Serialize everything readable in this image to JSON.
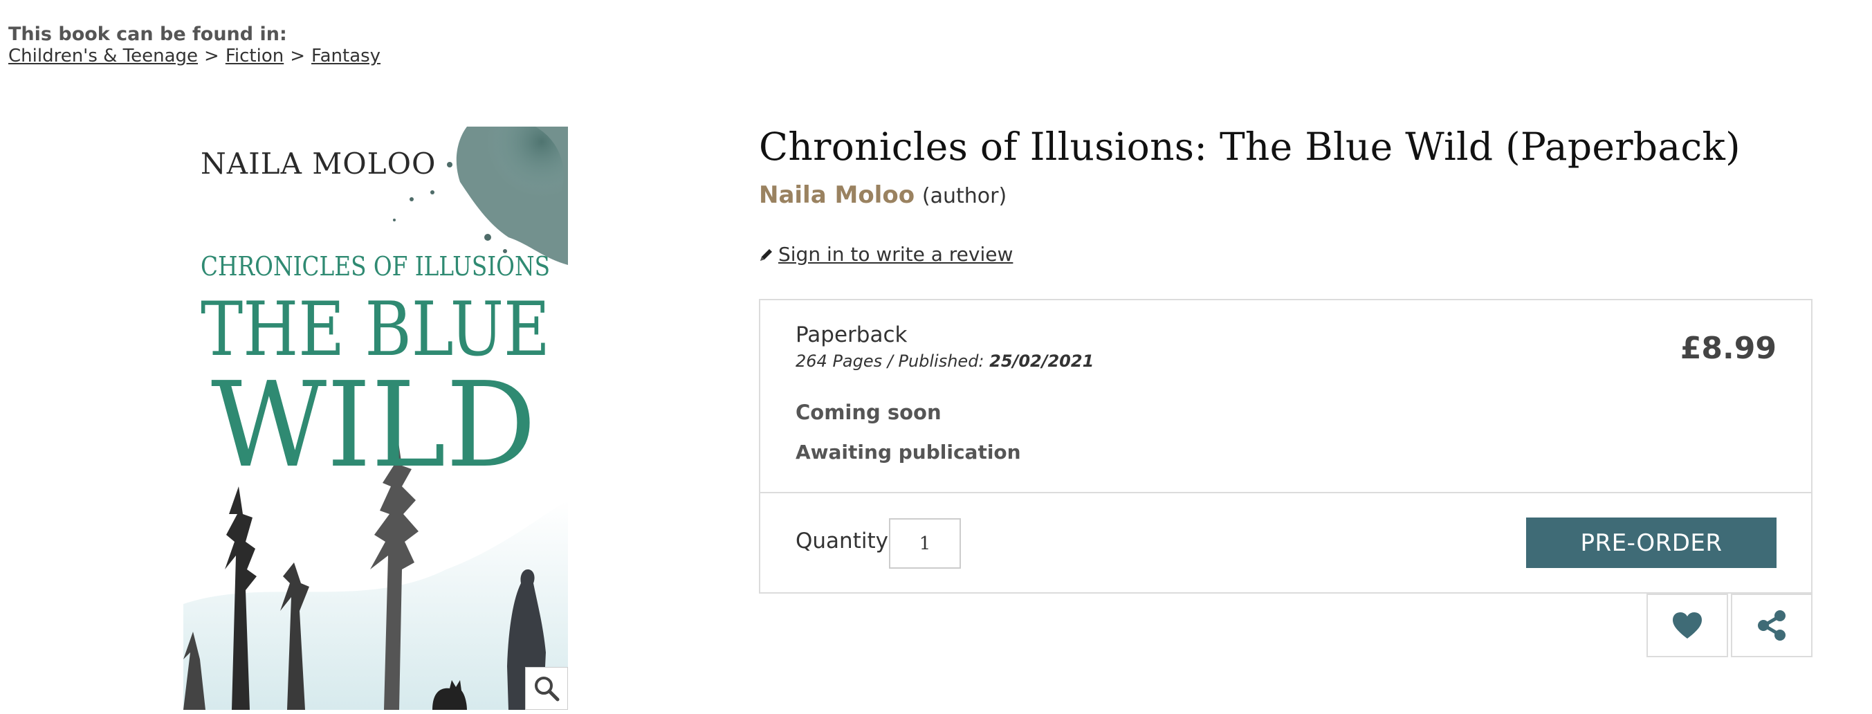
{
  "breadcrumb": {
    "label": "This book can be found in:",
    "items": [
      "Children's & Teenage",
      "Fiction",
      "Fantasy"
    ],
    "separator": ">"
  },
  "cover": {
    "author": "NAILA MOLOO",
    "series": "CHRONICLES OF ILLUSIONS",
    "title_line1": "THE BLUE",
    "title_line2": "WILD",
    "zoom_icon": "magnifier-icon"
  },
  "product": {
    "title": "Chronicles of Illusions: The Blue Wild (Paperback)",
    "author_name": "Naila Moloo",
    "author_role": "(author)",
    "review_link": "Sign in to write a review",
    "review_icon": "pencil-icon"
  },
  "buybox": {
    "format": "Paperback",
    "pages_published_prefix": "264 Pages / Published: ",
    "published_date": "25/02/2021",
    "price": "£8.99",
    "status_primary": "Coming soon",
    "status_secondary": "Awaiting publication",
    "quantity_label": "Quantity",
    "quantity_value": "1",
    "preorder_label": "PRE-ORDER"
  },
  "actions": {
    "wishlist_icon": "heart-icon",
    "share_icon": "share-icon"
  },
  "colors": {
    "accent": "#3f6b76",
    "author": "#9a8260",
    "cover_teal": "#2f8a72"
  }
}
